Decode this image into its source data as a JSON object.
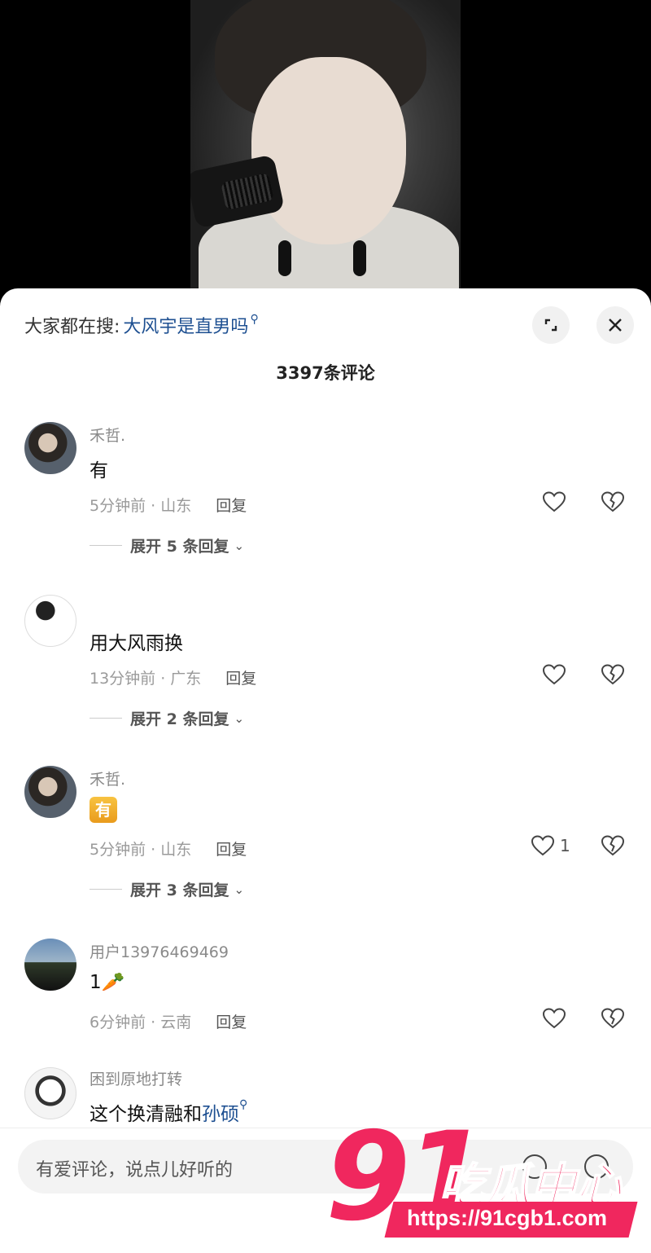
{
  "header": {
    "search_prefix": "大家都在搜:",
    "search_term": "大风宇是直男吗",
    "expand_icon": "expand-icon",
    "close_icon": "close-icon"
  },
  "comment_count": "3397条评论",
  "comments": [
    {
      "username": "禾哲.",
      "text": "有",
      "time_location": "5分钟前 · 山东",
      "reply": "回复",
      "likes": "",
      "expand": "展开 5 条回复"
    },
    {
      "username": "",
      "text": "用大风雨换",
      "time_location": "13分钟前 · 广东",
      "reply": "回复",
      "likes": "",
      "expand": "展开 2 条回复"
    },
    {
      "username": "禾哲.",
      "text": "有",
      "time_location": "5分钟前 · 山东",
      "reply": "回复",
      "likes": "1",
      "expand": "展开 3 条回复"
    },
    {
      "username": "用户13976469469",
      "text": "1🥕",
      "time_location": "6分钟前 · 云南",
      "reply": "回复",
      "likes": "",
      "expand": ""
    },
    {
      "username": "困到原地打转",
      "text_prefix": "这个换清融和",
      "text_link": "孙硕",
      "time_location": "",
      "reply": "",
      "likes": "",
      "expand": ""
    }
  ],
  "input": {
    "placeholder": "有爱评论，说点儿好听的"
  },
  "watermark": {
    "number": "91",
    "brand": "吃瓜中心",
    "url": "https://91cgb1.com"
  }
}
